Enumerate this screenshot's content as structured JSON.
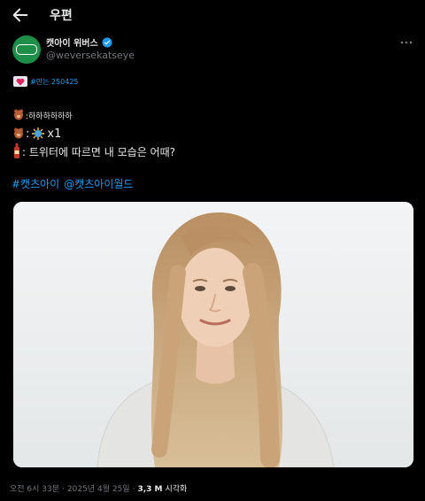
{
  "header": {
    "title": "우편"
  },
  "author": {
    "display_name": "캣아이 위버스",
    "handle": "@weversekatseye",
    "avatar_text": "WEVERSE"
  },
  "post": {
    "tag_line": "#만는 250425",
    "line1_text": ":하하하하하하",
    "line2_text": "x1",
    "line2_prefix": ":",
    "line3_text": ": 트위터에 따르면 내 모습은 어때?",
    "hashtags": [
      "#캣츠아이",
      "@캣츠아이월드"
    ]
  },
  "meta": {
    "time": "오전 6시 33분",
    "separator": "·",
    "date": "2025년 4월 25일",
    "views_count": "3,3 M",
    "views_label": "시각화"
  },
  "colors": {
    "accent": "#1d9bf0",
    "avatar_bg": "#1e8f49",
    "muted": "#71767b"
  }
}
